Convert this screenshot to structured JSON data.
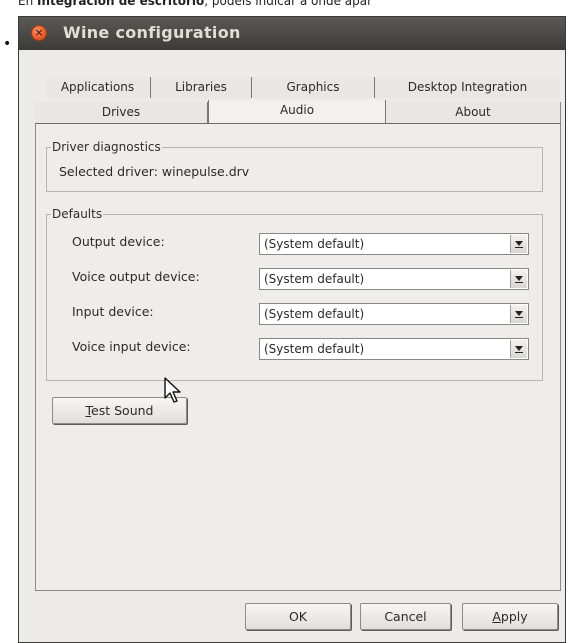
{
  "caption": {
    "prefix": "En ",
    "bold": "Integración de escritorio",
    "suffix": ", podeis indicar a onde apar"
  },
  "window": {
    "title": "Wine configuration"
  },
  "tabs": {
    "row1": [
      "Applications",
      "Libraries",
      "Graphics",
      "Desktop Integration"
    ],
    "row2": [
      "Drives",
      "Audio",
      "About"
    ],
    "active": "Audio"
  },
  "driver_diagnostics": {
    "legend": "Driver diagnostics",
    "selected_driver": "Selected driver: winepulse.drv"
  },
  "defaults": {
    "legend": "Defaults",
    "rows": [
      {
        "label": "Output device:",
        "value": "(System default)"
      },
      {
        "label": "Voice output device:",
        "value": "(System default)"
      },
      {
        "label": "Input device:",
        "value": "(System default)"
      },
      {
        "label": "Voice input device:",
        "value": "(System default)"
      }
    ]
  },
  "buttons": {
    "test_sound_mnemonic": "T",
    "test_sound_rest": "est Sound",
    "ok": "OK",
    "cancel": "Cancel",
    "apply_mnemonic": "A",
    "apply_rest": "pply"
  }
}
